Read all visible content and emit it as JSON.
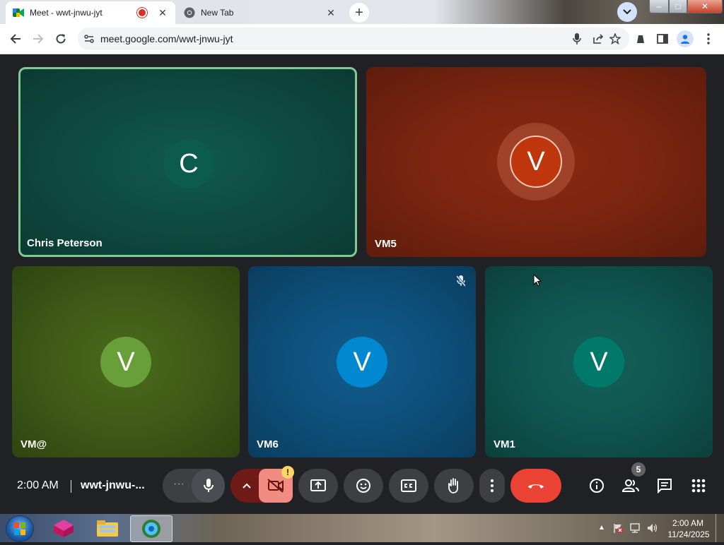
{
  "browser": {
    "tabs": [
      {
        "title": "Meet - wwt-jnwu-jyt",
        "active": true,
        "recording": true
      },
      {
        "title": "New Tab",
        "active": false
      }
    ],
    "new_tab_symbol": "+",
    "url": "meet.google.com/wwt-jnwu-jyt",
    "window_controls": {
      "minimize": "–",
      "maximize": "□",
      "close": "✕"
    }
  },
  "meet": {
    "tiles": [
      {
        "name": "Chris Peterson",
        "initial": "C",
        "avatar_color": "#0b5c4c",
        "bg": "#0d4d42",
        "active_speaker": true
      },
      {
        "name": "VM5",
        "initial": "V",
        "avatar_color": "#bf360c",
        "bg": "#7a2410"
      },
      {
        "name": "VM@",
        "initial": "V",
        "avatar_color": "#689f38",
        "bg": "#3f5a17"
      },
      {
        "name": "VM6",
        "initial": "V",
        "avatar_color": "#0288d1",
        "bg": "#0d4f7a",
        "muted": true
      },
      {
        "name": "VM1",
        "initial": "V",
        "avatar_color": "#00796b",
        "bg": "#0f5450"
      }
    ],
    "bottom_bar": {
      "time": "2:00 AM",
      "meeting_code": "wwt-jnwu-...",
      "more_symbol": "···",
      "warning_symbol": "!",
      "people_count": "5"
    }
  },
  "taskbar": {
    "time": "2:00 AM",
    "date": "11/24/2025"
  },
  "colors": {
    "accent_border": "#81c995",
    "end_call": "#ea4335",
    "camera_off": "#f28b82"
  }
}
